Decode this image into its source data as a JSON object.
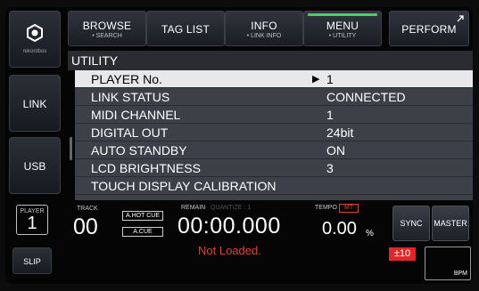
{
  "side": {
    "logo_label": "rekordbox",
    "link_label": "LINK",
    "usb_label": "USB",
    "slip_label": "SLIP",
    "player_label": "PLAYER",
    "player_number": "1"
  },
  "tabs": [
    {
      "label": "BROWSE",
      "sub": "• SEARCH"
    },
    {
      "label": "TAG LIST",
      "sub": ""
    },
    {
      "label": "INFO",
      "sub": "• LINK INFO"
    },
    {
      "label": "MENU",
      "sub": "• UTILITY"
    },
    {
      "label": "PERFORM",
      "sub": ""
    }
  ],
  "page_title": "UTILITY",
  "utility_items": [
    {
      "label": "PLAYER No.",
      "value": "1",
      "selected": true
    },
    {
      "label": "LINK STATUS",
      "value": "CONNECTED"
    },
    {
      "label": "MIDI CHANNEL",
      "value": "1"
    },
    {
      "label": "DIGITAL OUT",
      "value": "24bit"
    },
    {
      "label": "AUTO STANDBY",
      "value": "ON"
    },
    {
      "label": "LCD BRIGHTNESS",
      "value": "3"
    },
    {
      "label": "TOUCH DISPLAY CALIBRATION",
      "value": ""
    }
  ],
  "deck": {
    "track_label": "TRACK",
    "track_number": "00",
    "a_hot_cue": "A.HOT CUE",
    "a_cue": "A.CUE",
    "remain_label": "REMAIN",
    "quantize_label": "QUANTIZE : 1",
    "time_display": "00:00.000",
    "status_text": "Not Loaded.",
    "tempo_label": "TEMPO",
    "mt_label": "MT",
    "tempo_value": "0.00",
    "tempo_unit": "%",
    "tempo_range": "±10",
    "sync_label": "SYNC",
    "master_label": "MASTER",
    "bpm_label": "BPM"
  }
}
